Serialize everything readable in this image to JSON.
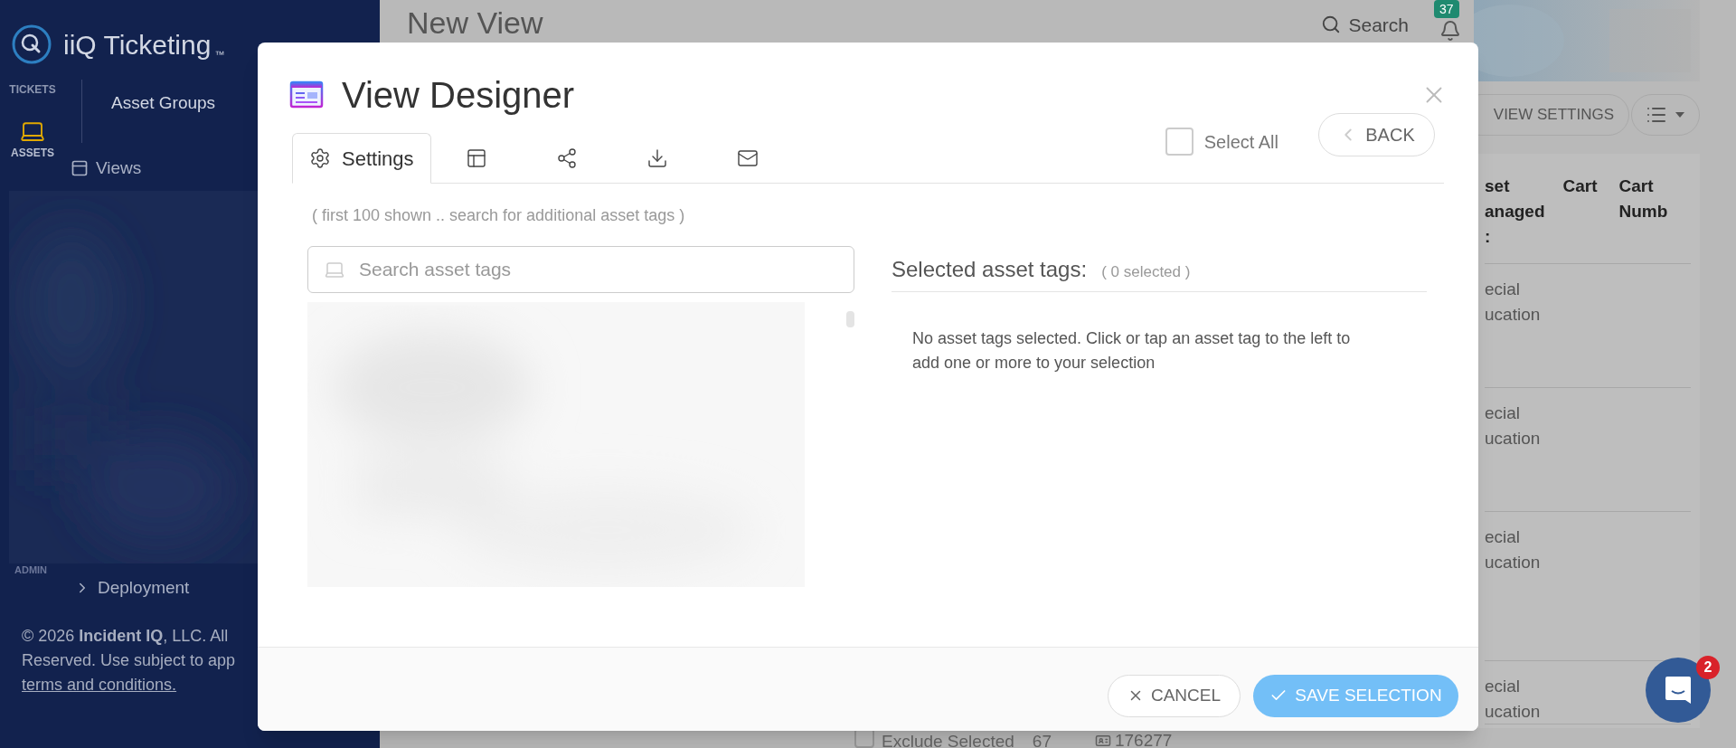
{
  "sidebar": {
    "brand": "iiQ Ticketing",
    "brand_mark": "™",
    "nav": [
      {
        "kind": "tickets",
        "label": "TICKETS",
        "selected": false
      },
      {
        "kind": "assets",
        "label": "ASSETS",
        "selected": true
      }
    ],
    "section_title": "Asset Groups",
    "items": [
      {
        "label": "Views"
      }
    ],
    "admin_label": "ADMIN",
    "deployment": "Deployment",
    "footer": {
      "lines": [
        "© 2026 **Incident IQ**, LLC. All",
        "Reserved. Use subject to app"
      ],
      "link": "terms and conditions."
    }
  },
  "page": {
    "title": "New View",
    "search": "Search",
    "notifications": "37",
    "view_settings": "VIEW SETTINGS",
    "columns": [
      {
        "lines": [
          "set",
          "anaged",
          ":"
        ]
      },
      {
        "lines": [
          "Cart"
        ]
      },
      {
        "lines": [
          "Cart",
          "Numb"
        ]
      }
    ],
    "rows": [
      {
        "lines": [
          "ecial",
          "ucation"
        ]
      },
      {
        "lines": [
          "ecial",
          "ucation"
        ]
      },
      {
        "lines": [
          "ecial",
          "ucation"
        ]
      },
      {
        "lines": [
          "ecial",
          "ucation"
        ]
      }
    ],
    "exclude": {
      "label": "Exclude Selected",
      "checked": false
    },
    "count": "67",
    "asset_tag": "176277"
  },
  "chat": {
    "badge": "2"
  },
  "modal": {
    "title": "View Designer",
    "tabs": [
      {
        "kind": "settings",
        "label": "Settings",
        "selected": true
      },
      {
        "kind": "layout",
        "selected": false
      },
      {
        "kind": "share",
        "selected": false
      },
      {
        "kind": "download",
        "selected": false
      },
      {
        "kind": "email",
        "selected": false
      }
    ],
    "select_all": {
      "label": "Select All",
      "checked": false
    },
    "back": "BACK",
    "hint": "( first 100 shown .. search for additional asset tags )",
    "search": {
      "placeholder": "Search asset tags"
    },
    "selected_heading": "Selected asset tags:",
    "selected_count": "( 0 selected )",
    "empty_message": "No asset tags selected. Click or tap an asset tag to the left to add one or more to your selection",
    "cancel": "CANCEL",
    "save": "SAVE SELECTION"
  }
}
